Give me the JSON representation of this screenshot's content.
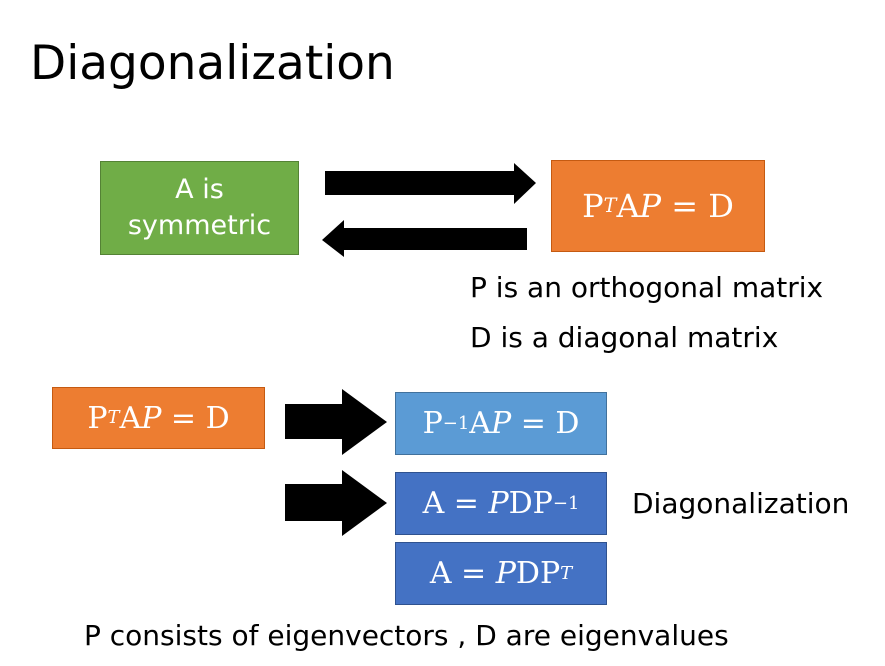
{
  "slide": {
    "title": "Diagonalization",
    "box_symmetric": {
      "line1": "A is",
      "line2": "symmetric"
    },
    "box_ptap": {
      "base": "P",
      "sup": "T",
      "mid": "A",
      "var": "P",
      "eq": " = D"
    },
    "box_ptap_2": {
      "base": "P",
      "sup": "T",
      "mid": "A",
      "var": "P",
      "eq": " = D"
    },
    "box_pinv": {
      "base": "P",
      "sup": "−1",
      "mid": "A",
      "var": "P",
      "eq": " = D"
    },
    "box_apdpinv": {
      "lhs": "A = ",
      "var": "P",
      "mid": "DP",
      "sup": "−1"
    },
    "box_apdpt": {
      "lhs": "A = ",
      "var": "P",
      "mid": "DP",
      "sup": "T"
    },
    "note_orthogonal": "P is an orthogonal matrix",
    "note_diagonal": "D is a diagonal matrix",
    "label_diagonalization": "Diagonalization",
    "footer": "P consists of eigenvectors , D are eigenvalues"
  },
  "colors": {
    "green": "#70ad47",
    "orange": "#ed7d31",
    "light_blue": "#5b9bd5",
    "blue": "#4472c4",
    "arrow": "#000000"
  }
}
